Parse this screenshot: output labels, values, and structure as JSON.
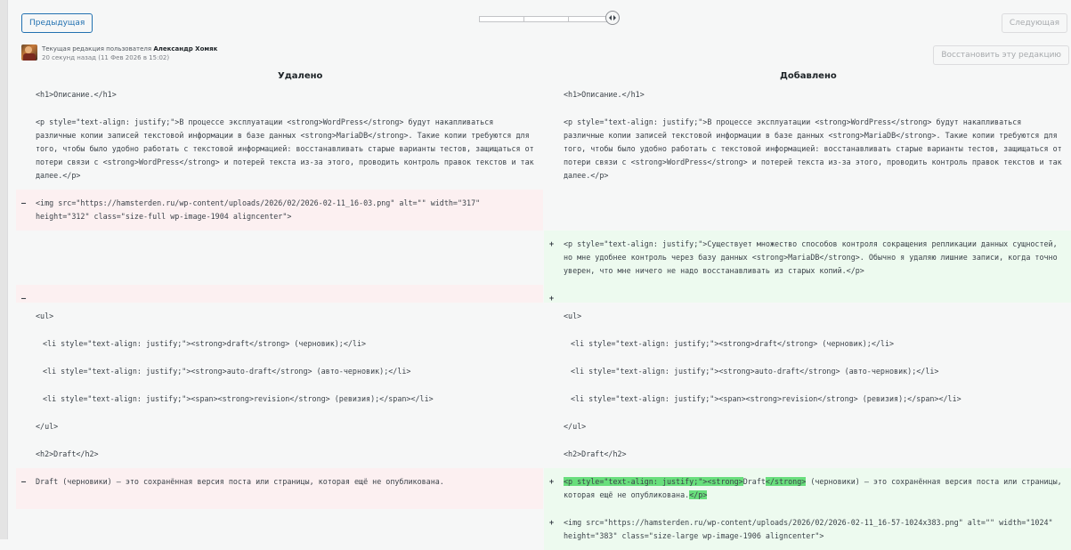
{
  "nav": {
    "prev_label": "Предыдущая",
    "next_label": "Следующая",
    "restore_label": "Восстановить эту редакцию"
  },
  "revision": {
    "line1_prefix": "Текущая редакция пользователя",
    "author": "Александр Хомяк",
    "time": "20 секунд назад (11 Фев 2026 в 15:02)"
  },
  "columns": {
    "removed": "Удалено",
    "added": "Добавлено"
  },
  "markers": {
    "del": "–",
    "add": "+"
  },
  "diff": {
    "h1": "<h1>Описание.</h1>",
    "p1": "<p style=\"text-align: justify;\">В процессе эксплуатации <strong>WordPress</strong> будут накапливаться различные копии записей текстовой информации в базе данных <strong>MariaDB</strong>. Такие копии требуются для того, чтобы было удобно работать с текстовой информацией: восстанавливать старые варианты тестов, защищаться от потери связи с <strong>WordPress</strong> и потерей текста из-за этого, проводить контроль правок текстов и так далее.</p>",
    "img_removed": "<img src=\"https://hamsterden.ru/wp-content/uploads/2026/02/2026-02-11_16-03.png\" alt=\"\" width=\"317\" height=\"312\" class=\"size-full wp-image-1904 aligncenter\">",
    "p_added": "<p style=\"text-align: justify;\">Существует множество способов контроля сокращения репликации данных сущностей, но мне удобнее контроль через базу данных <strong>MariaDB</strong>. Обычно я удаляю лишние записи, когда точно уверен, что мне ничего не надо восстанавливать из старых копий.</p>",
    "ul_open": "<ul>",
    "li1": "<li style=\"text-align: justify;\"><strong>draft</strong> (черновик);</li>",
    "li2": "<li style=\"text-align: justify;\"><strong>auto-draft</strong> (авто-черновик);</li>",
    "li3": "<li style=\"text-align: justify;\"><span><strong>revision</strong> (ревизия);</span></li>",
    "ul_close": "</ul>",
    "h2": "<h2>Draft</h2>",
    "draft_removed": "Draft (черновики) — это сохранённая версия поста или страницы, которая ещё не опубликована.",
    "draft_added": {
      "hl1": "<p style=\"text-align: justify;\"><strong>",
      "t1": "Draft",
      "hl2": "</strong>",
      "t2": " (черновики) — это сохранённая версия поста или страницы, которая ещё не опубликована.",
      "hl3": "</p>"
    },
    "img_added": "<img src=\"https://hamsterden.ru/wp-content/uploads/2026/02/2026-02-11_16-57-1024x383.png\" alt=\"\" width=\"1024\" height=\"383\" class=\"size-large wp-image-1906 aligncenter\">"
  }
}
